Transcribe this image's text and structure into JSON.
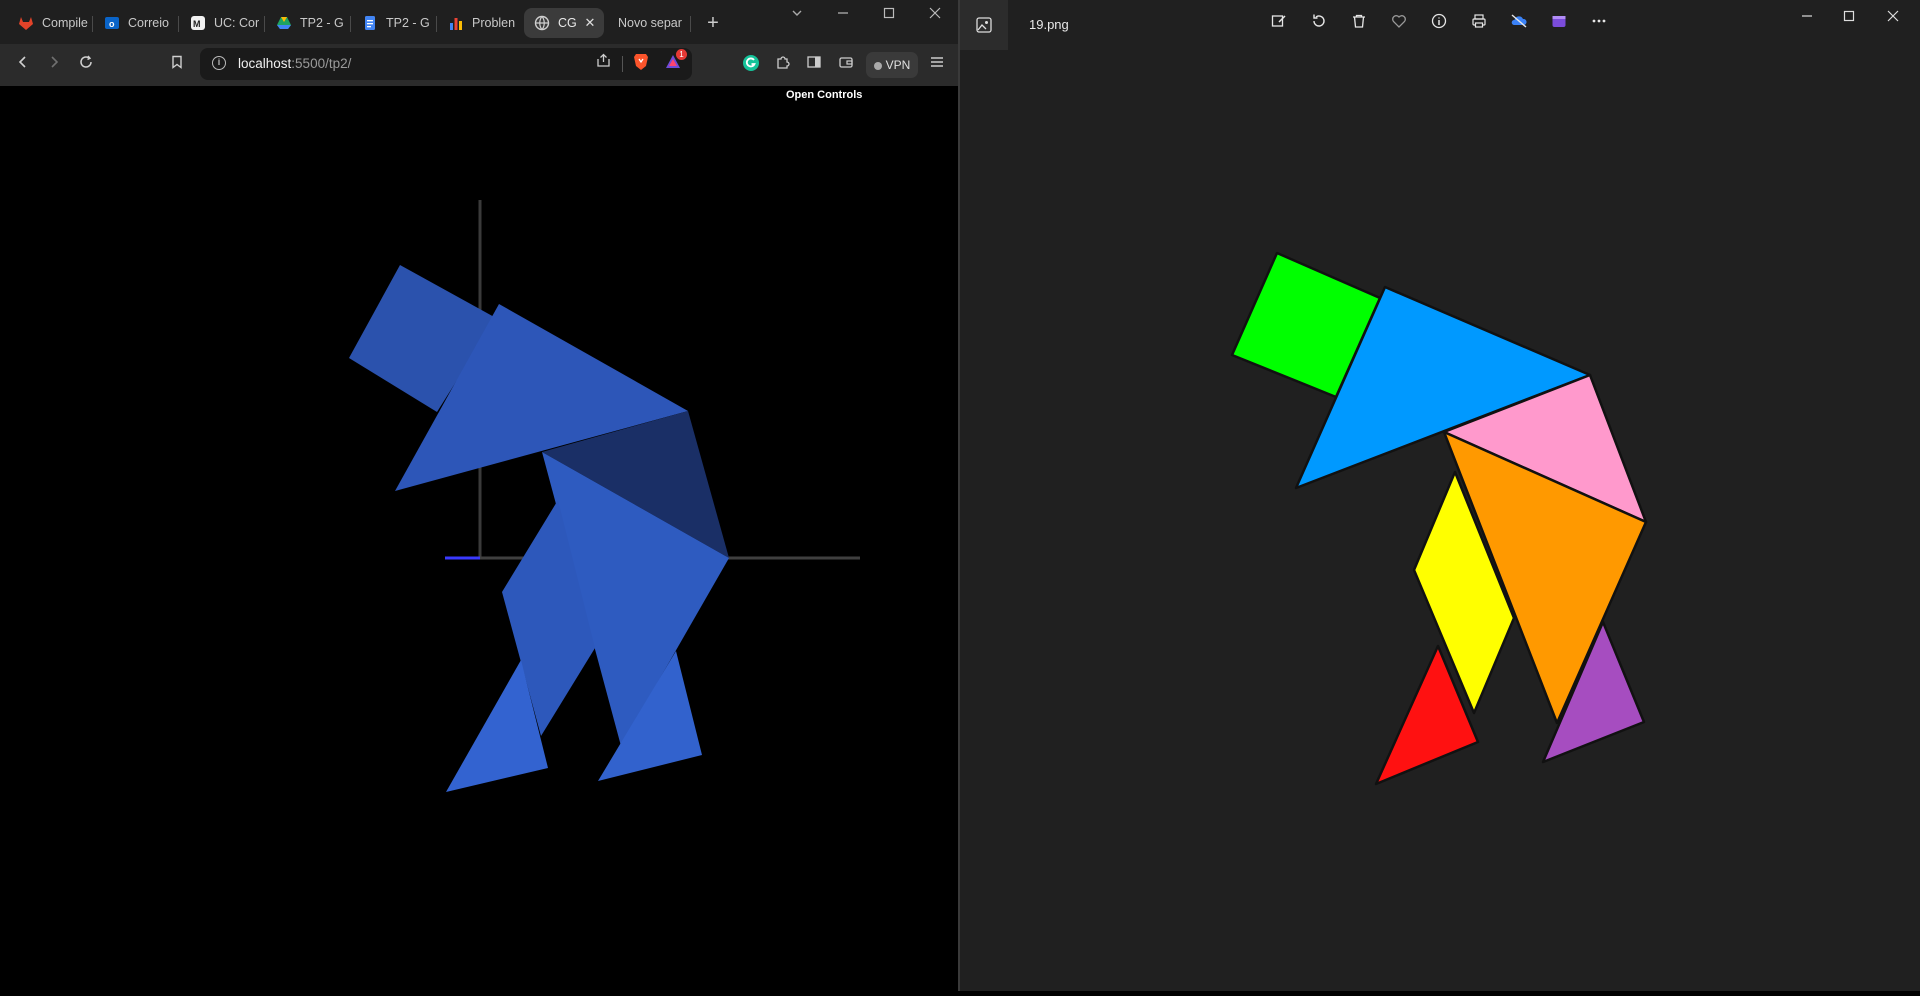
{
  "browser": {
    "tabs": [
      {
        "title": "Compile",
        "icon": "gitlab-icon"
      },
      {
        "title": "Correio",
        "icon": "outlook-icon"
      },
      {
        "title": "UC: Cor",
        "icon": "uc-icon"
      },
      {
        "title": "TP2 - G",
        "icon": "drive-icon"
      },
      {
        "title": "TP2 - G",
        "icon": "docs-icon"
      },
      {
        "title": "Problen",
        "icon": "chart-icon"
      },
      {
        "title": "CG",
        "icon": "globe-icon"
      },
      {
        "title": "Novo separ",
        "icon": ""
      }
    ],
    "active_tab_close": "✕",
    "new_tab_label": "+",
    "url_host": "localhost",
    "url_path": ":5500/tp2/",
    "vpn_label": "VPN",
    "shield_badge": "1",
    "open_controls_label": "Open Controls"
  },
  "photos": {
    "filename": "19.png",
    "colors": {
      "green": "#00ff00",
      "blue": "#0099ff",
      "pink": "#ff99cc",
      "orange": "#ff9900",
      "yellow": "#ffff00",
      "red": "#ff1111",
      "purple": "#a64dc0",
      "background": "#202020"
    }
  },
  "scene": {
    "shape_color": "#2f5cc6",
    "shape_dark": "#1a2f66",
    "axis_color": "#555555",
    "axis_accent": "#3a3aff"
  }
}
